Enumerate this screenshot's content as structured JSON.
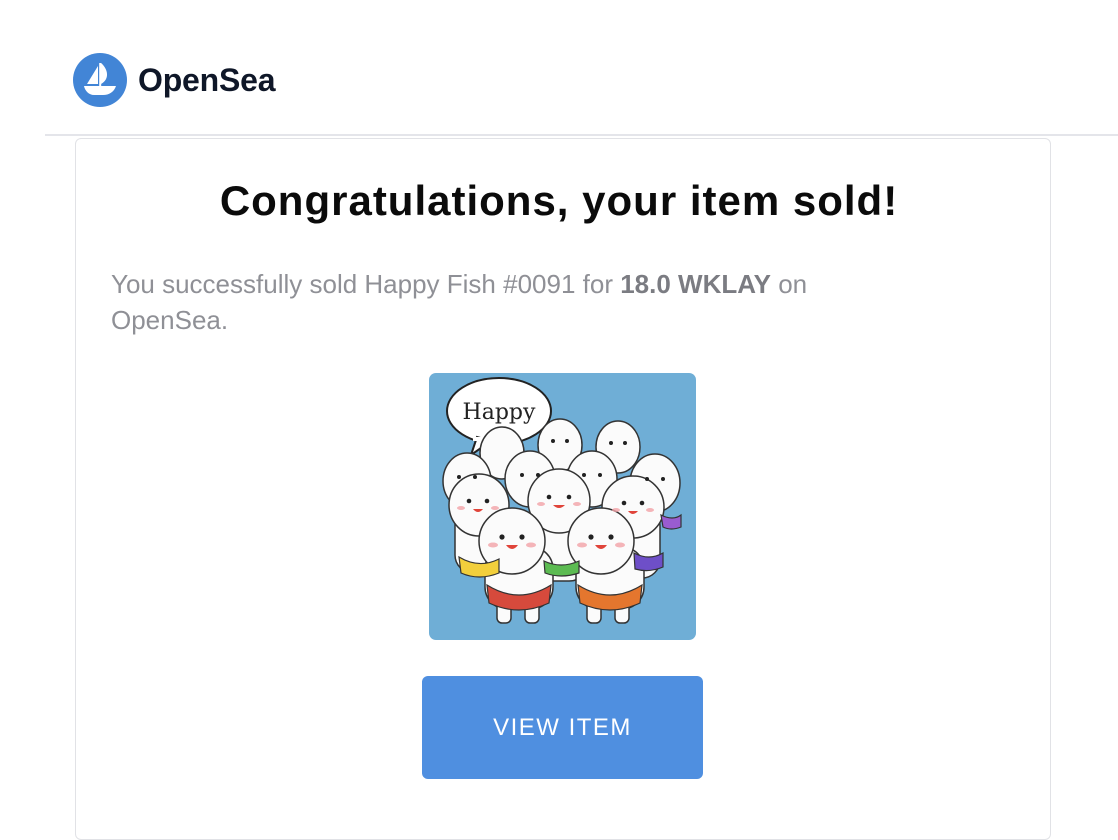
{
  "header": {
    "brand_name": "OpenSea",
    "logo_icon": "ship-icon",
    "brand_color": "#4285d6"
  },
  "email": {
    "title": "Congratulations, your item sold!",
    "message_prefix": "You successfully sold Happy Fish #0091 for ",
    "price": "18.0 WKLAY",
    "message_suffix": " on OpenSea.",
    "item_image": {
      "speech_bubble_text": "Happy"
    },
    "view_button_label": "VIEW ITEM",
    "button_color": "#4f8fe0"
  }
}
